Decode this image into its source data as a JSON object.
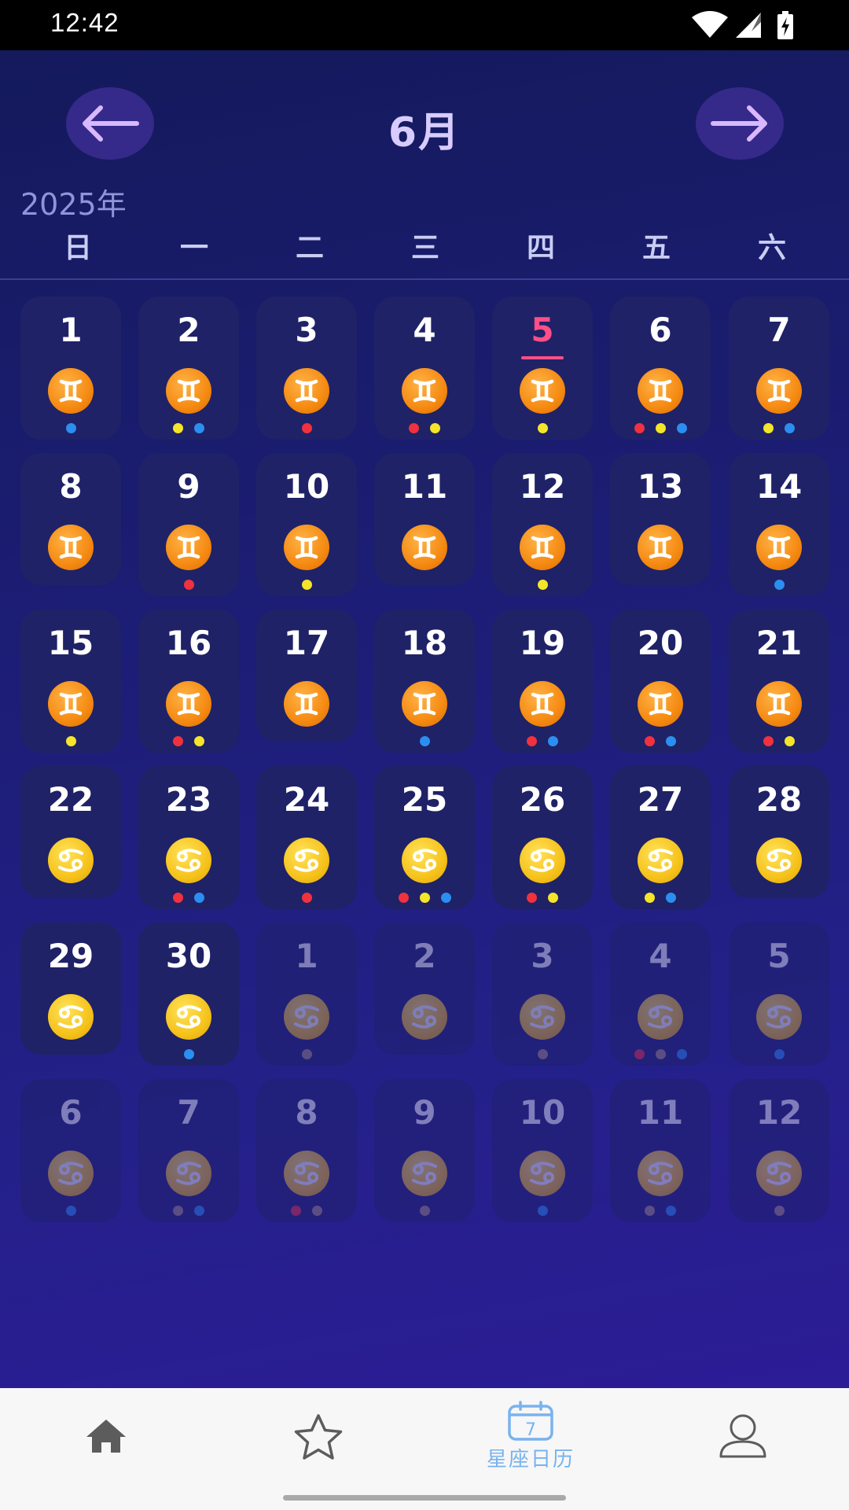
{
  "status_bar": {
    "time": "12:42"
  },
  "calendar": {
    "month_title": "6月",
    "year_label": "2025年",
    "weekdays": [
      "日",
      "一",
      "二",
      "三",
      "四",
      "五",
      "六"
    ],
    "dot_colors": {
      "red": "#f0323e",
      "yellow": "#f4e52a",
      "blue": "#2a8ff0",
      "gray": "#a58f7a"
    },
    "today": "5",
    "days": [
      {
        "day": "1",
        "sign": "gemini",
        "dots": [
          "blue"
        ],
        "current": true
      },
      {
        "day": "2",
        "sign": "gemini",
        "dots": [
          "yellow",
          "blue"
        ],
        "current": true
      },
      {
        "day": "3",
        "sign": "gemini",
        "dots": [
          "red"
        ],
        "current": true
      },
      {
        "day": "4",
        "sign": "gemini",
        "dots": [
          "red",
          "yellow"
        ],
        "current": true
      },
      {
        "day": "5",
        "sign": "gemini",
        "dots": [
          "yellow"
        ],
        "current": true,
        "today": true
      },
      {
        "day": "6",
        "sign": "gemini",
        "dots": [
          "red",
          "yellow",
          "blue"
        ],
        "current": true
      },
      {
        "day": "7",
        "sign": "gemini",
        "dots": [
          "yellow",
          "blue"
        ],
        "current": true
      },
      {
        "day": "8",
        "sign": "gemini",
        "dots": [],
        "current": true
      },
      {
        "day": "9",
        "sign": "gemini",
        "dots": [
          "red"
        ],
        "current": true
      },
      {
        "day": "10",
        "sign": "gemini",
        "dots": [
          "yellow"
        ],
        "current": true
      },
      {
        "day": "11",
        "sign": "gemini",
        "dots": [],
        "current": true
      },
      {
        "day": "12",
        "sign": "gemini",
        "dots": [
          "yellow"
        ],
        "current": true
      },
      {
        "day": "13",
        "sign": "gemini",
        "dots": [],
        "current": true
      },
      {
        "day": "14",
        "sign": "gemini",
        "dots": [
          "blue"
        ],
        "current": true
      },
      {
        "day": "15",
        "sign": "gemini",
        "dots": [
          "yellow"
        ],
        "current": true
      },
      {
        "day": "16",
        "sign": "gemini",
        "dots": [
          "red",
          "yellow"
        ],
        "current": true
      },
      {
        "day": "17",
        "sign": "gemini",
        "dots": [],
        "current": true
      },
      {
        "day": "18",
        "sign": "gemini",
        "dots": [
          "blue"
        ],
        "current": true
      },
      {
        "day": "19",
        "sign": "gemini",
        "dots": [
          "red",
          "blue"
        ],
        "current": true
      },
      {
        "day": "20",
        "sign": "gemini",
        "dots": [
          "red",
          "blue"
        ],
        "current": true
      },
      {
        "day": "21",
        "sign": "gemini",
        "dots": [
          "red",
          "yellow"
        ],
        "current": true
      },
      {
        "day": "22",
        "sign": "cancer",
        "dots": [],
        "current": true
      },
      {
        "day": "23",
        "sign": "cancer",
        "dots": [
          "red",
          "blue"
        ],
        "current": true
      },
      {
        "day": "24",
        "sign": "cancer",
        "dots": [
          "red"
        ],
        "current": true
      },
      {
        "day": "25",
        "sign": "cancer",
        "dots": [
          "red",
          "yellow",
          "blue"
        ],
        "current": true
      },
      {
        "day": "26",
        "sign": "cancer",
        "dots": [
          "red",
          "yellow"
        ],
        "current": true
      },
      {
        "day": "27",
        "sign": "cancer",
        "dots": [
          "yellow",
          "blue"
        ],
        "current": true
      },
      {
        "day": "28",
        "sign": "cancer",
        "dots": [],
        "current": true
      },
      {
        "day": "29",
        "sign": "cancer",
        "dots": [],
        "current": true
      },
      {
        "day": "30",
        "sign": "cancer",
        "dots": [
          "blue"
        ],
        "current": true
      },
      {
        "day": "1",
        "sign": "cancer",
        "dots": [
          "gray"
        ],
        "current": false
      },
      {
        "day": "2",
        "sign": "cancer",
        "dots": [],
        "current": false
      },
      {
        "day": "3",
        "sign": "cancer",
        "dots": [
          "gray"
        ],
        "current": false
      },
      {
        "day": "4",
        "sign": "cancer",
        "dots": [
          "red",
          "gray",
          "blue"
        ],
        "current": false
      },
      {
        "day": "5",
        "sign": "cancer",
        "dots": [
          "blue"
        ],
        "current": false
      },
      {
        "day": "6",
        "sign": "cancer",
        "dots": [
          "blue"
        ],
        "current": false
      },
      {
        "day": "7",
        "sign": "cancer",
        "dots": [
          "gray",
          "blue"
        ],
        "current": false
      },
      {
        "day": "8",
        "sign": "cancer",
        "dots": [
          "red",
          "gray"
        ],
        "current": false
      },
      {
        "day": "9",
        "sign": "cancer",
        "dots": [
          "gray"
        ],
        "current": false
      },
      {
        "day": "10",
        "sign": "cancer",
        "dots": [
          "blue"
        ],
        "current": false
      },
      {
        "day": "11",
        "sign": "cancer",
        "dots": [
          "gray",
          "blue"
        ],
        "current": false
      },
      {
        "day": "12",
        "sign": "cancer",
        "dots": [
          "gray"
        ],
        "current": false
      }
    ]
  },
  "bottom_nav": {
    "active_color": "#78b3ef",
    "inactive_color": "#5c5c5c",
    "tabs": [
      {
        "icon": "home-icon",
        "label": "",
        "active": false
      },
      {
        "icon": "star-icon",
        "label": "",
        "active": false
      },
      {
        "icon": "calendar-icon",
        "label": "星座日历",
        "calendar_number": "7",
        "active": true
      },
      {
        "icon": "profile-icon",
        "label": "",
        "active": false
      }
    ]
  }
}
